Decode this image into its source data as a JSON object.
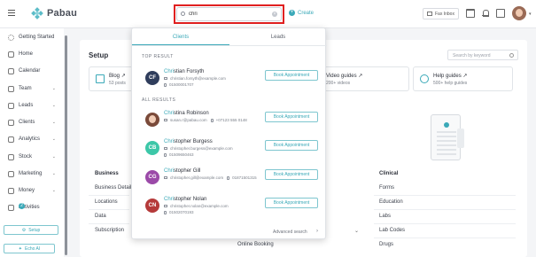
{
  "app": {
    "name": "Pabau"
  },
  "header": {
    "search_value": "chri",
    "create_label": "Create",
    "fax_label": "Fax Inbox"
  },
  "sidebar": {
    "items": [
      {
        "label": "Getting Started",
        "has_caret": false
      },
      {
        "label": "Home",
        "has_caret": false
      },
      {
        "label": "Calendar",
        "has_caret": false
      },
      {
        "label": "Team",
        "has_caret": true
      },
      {
        "label": "Leads",
        "has_caret": true
      },
      {
        "label": "Clients",
        "has_caret": true
      },
      {
        "label": "Analytics",
        "has_caret": true
      },
      {
        "label": "Stock",
        "has_caret": true
      },
      {
        "label": "Marketing",
        "has_caret": true
      },
      {
        "label": "Money",
        "has_caret": true
      },
      {
        "label": "Activities",
        "has_caret": false
      }
    ],
    "activities_badge": "2",
    "setup_label": "Setup",
    "echo_label": "Echo AI"
  },
  "setup": {
    "title": "Setup",
    "search_placeholder": "Search by keyword",
    "cards": {
      "blog": {
        "title": "Blog",
        "subtitle": "53 posts"
      },
      "video": {
        "title": "Video guides",
        "subtitle": "200+ videos"
      },
      "help": {
        "title": "Help guides",
        "subtitle": "500+ help guides"
      }
    },
    "business": {
      "heading": "Business",
      "items": [
        "Business Details",
        "Locations",
        "Data",
        "Subscription"
      ]
    },
    "online_booking": "Online Booking",
    "clinical": {
      "heading": "Clinical",
      "items": [
        "Forms",
        "Education",
        "Labs",
        "Lab Codes",
        "Drugs"
      ]
    }
  },
  "dropdown": {
    "tabs": [
      "Clients",
      "Leads"
    ],
    "top_result_label": "TOP RESULT",
    "all_results_label": "ALL RESULTS",
    "book_label": "Book Appointment",
    "advanced_search_label": "Advanced search",
    "top_result": {
      "initials": "CF",
      "name_match": "Chri",
      "name_rest": "stian Forsyth",
      "email": "christian.forsyth@example.com",
      "phone": "01500001707",
      "extra_phone": "",
      "color": "#2f3d5c",
      "photo": false
    },
    "results": [
      {
        "initials": "",
        "name_match": "Chri",
        "name_rest": "stina Robinson",
        "email": "susan.r@pabau.com",
        "phone": "",
        "extra_phone": "+07123 555 0148",
        "color": "#7a4a3a",
        "photo": true
      },
      {
        "initials": "CB",
        "name_match": "Chri",
        "name_rest": "stopher Burgess",
        "email": "christopher.burgess@example.com",
        "phone": "01509650463",
        "extra_phone": "",
        "color": "#3cc7a8",
        "photo": false
      },
      {
        "initials": "CG",
        "name_match": "Chri",
        "name_rest": "stopher Gill",
        "email": "christopher.gill@example.com",
        "phone": "",
        "extra_phone": "01871501315",
        "color": "#9b4aa8",
        "photo": false
      },
      {
        "initials": "CN",
        "name_match": "Chri",
        "name_rest": "stopher Nolan",
        "email": "christopher.nolan@example.com",
        "phone": "01502070193",
        "extra_phone": "",
        "color": "#b53a3a",
        "photo": false
      }
    ]
  }
}
